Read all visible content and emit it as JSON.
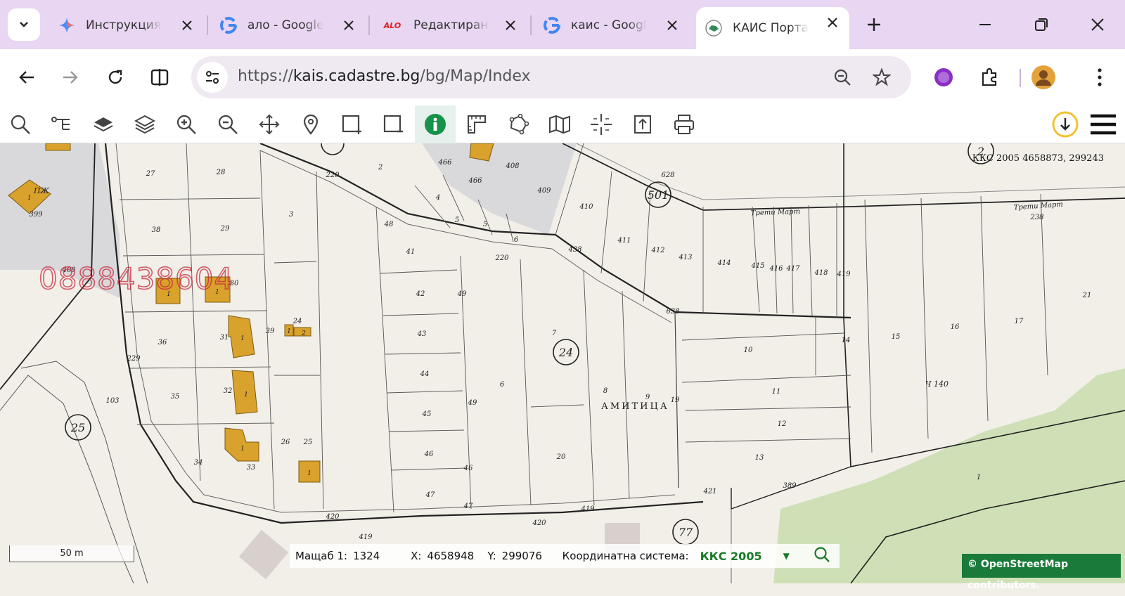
{
  "browser": {
    "tabs": [
      {
        "label": "Инструкция за",
        "icon": "gemini-icon",
        "active": false
      },
      {
        "label": "ало - Google",
        "icon": "google-icon",
        "active": false
      },
      {
        "label": "Редактиране",
        "icon": "alo-icon",
        "active": false
      },
      {
        "label": "каис - Google",
        "icon": "google-icon",
        "active": false
      },
      {
        "label": "КАИС Портал",
        "icon": "kais-icon",
        "active": true
      }
    ],
    "url_scheme": "https://",
    "url_host": "kais.cadastre.bg",
    "url_path": "/bg/Map/Index",
    "alo_favicon_text": "ALO"
  },
  "map": {
    "coordinate_readout": "ККС 2005 4658873, 299243",
    "watermark_phone": "0888438604",
    "street_labels": [
      "Трети Март",
      "Трети Март"
    ],
    "locality_label": "АМИТИЦА",
    "region_circles": [
      "501",
      "24",
      "25",
      "77",
      "2"
    ],
    "parcel_numbers": [
      "27",
      "28",
      "38",
      "29",
      "3",
      "2",
      "4",
      "5",
      "5",
      "6",
      "466",
      "466",
      "408",
      "409",
      "410",
      "411",
      "412",
      "413",
      "414",
      "415",
      "416",
      "417",
      "418",
      "419",
      "628",
      "438",
      "220",
      "220",
      "48",
      "41",
      "42",
      "43",
      "44",
      "45",
      "46",
      "47",
      "49",
      "49",
      "46",
      "47",
      "7",
      "6",
      "8",
      "9",
      "19",
      "20",
      "36",
      "31",
      "30",
      "32",
      "35",
      "34",
      "33",
      "26",
      "25",
      "24",
      "39",
      "229",
      "103",
      "400",
      "399",
      "10",
      "11",
      "12",
      "13",
      "14",
      "15",
      "16",
      "17",
      "21",
      "389",
      "421",
      "419",
      "420",
      "419",
      "420",
      "638",
      "238",
      "1"
    ],
    "building_labels": [
      "1",
      "1",
      "1",
      "1",
      "1",
      "1",
      "1",
      "2",
      "1"
    ],
    "other_labels": [
      "ПЖ",
      "Ч 140"
    ],
    "scale_bar_label": "50 m",
    "attribution": "© OpenStreetMap contributors."
  },
  "status": {
    "scale_label": "Мащаб 1:",
    "scale_value": "1324",
    "x_label": "X:",
    "x_value": "4658948",
    "y_label": "Y:",
    "y_value": "299076",
    "crs_label": "Координатна система:",
    "crs_value": "ККС 2005"
  },
  "colors": {
    "tabbar_bg": "#e8d6f2",
    "building": "#d9a22c",
    "forest": "#cfe0b7",
    "attribution_bg": "#1a7a3a",
    "crs_green": "#1a7a2a"
  }
}
